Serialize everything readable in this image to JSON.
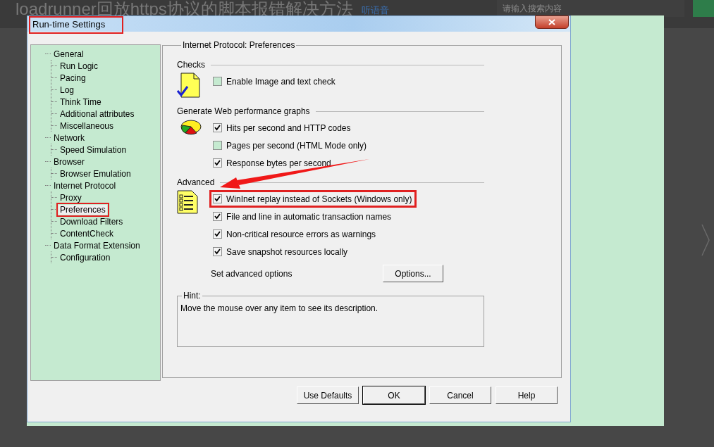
{
  "page": {
    "title": "loadrunner回放https协议的脚本报错解决方法",
    "listen_link": "听语音",
    "search": {
      "placeholder": "请输入搜索内容"
    }
  },
  "window": {
    "title": "Run-time Settings",
    "highlighted": true
  },
  "tree": [
    {
      "label": "General",
      "selected": false,
      "highlighted": false,
      "children": [
        {
          "label": "Run Logic",
          "selected": false,
          "highlighted": false
        },
        {
          "label": "Pacing",
          "selected": false,
          "highlighted": false
        },
        {
          "label": "Log",
          "selected": false,
          "highlighted": false
        },
        {
          "label": "Think Time",
          "selected": false,
          "highlighted": false
        },
        {
          "label": "Additional attributes",
          "selected": false,
          "highlighted": false
        },
        {
          "label": "Miscellaneous",
          "selected": false,
          "highlighted": false
        }
      ]
    },
    {
      "label": "Network",
      "selected": false,
      "highlighted": false,
      "children": [
        {
          "label": "Speed Simulation",
          "selected": false,
          "highlighted": false
        }
      ]
    },
    {
      "label": "Browser",
      "selected": false,
      "highlighted": false,
      "children": [
        {
          "label": "Browser Emulation",
          "selected": false,
          "highlighted": false
        }
      ]
    },
    {
      "label": "Internet Protocol",
      "selected": false,
      "highlighted": false,
      "children": [
        {
          "label": "Proxy",
          "selected": false,
          "highlighted": false
        },
        {
          "label": "Preferences",
          "selected": true,
          "highlighted": true
        },
        {
          "label": "Download Filters",
          "selected": false,
          "highlighted": false
        },
        {
          "label": "ContentCheck",
          "selected": false,
          "highlighted": false
        }
      ]
    },
    {
      "label": "Data Format Extension",
      "selected": false,
      "highlighted": false,
      "children": [
        {
          "label": "Configuration",
          "selected": false,
          "highlighted": false
        }
      ]
    }
  ],
  "panel": {
    "title": "Internet Protocol: Preferences",
    "sections": [
      {
        "title": "Checks",
        "kind": "document",
        "options": [
          {
            "label": "Enable Image and text check",
            "checked": false,
            "highlighted": false
          }
        ]
      },
      {
        "title": "Generate Web performance graphs",
        "kind": "pie",
        "options": [
          {
            "label": "Hits per second and HTTP codes",
            "checked": true,
            "highlighted": false
          },
          {
            "label": "Pages per second (HTML Mode only)",
            "checked": false,
            "highlighted": false
          },
          {
            "label": "Response bytes per second",
            "checked": true,
            "highlighted": false
          }
        ]
      },
      {
        "title": "Advanced",
        "kind": "list",
        "options": [
          {
            "label": "WinInet replay instead of Sockets (Windows only)",
            "checked": true,
            "highlighted": true
          },
          {
            "label": "File and line in automatic transaction names",
            "checked": true,
            "highlighted": false
          },
          {
            "label": "Non-critical resource errors as warnings",
            "checked": true,
            "highlighted": false
          },
          {
            "label": "Save snapshot resources locally",
            "checked": true,
            "highlighted": false
          }
        ]
      }
    ],
    "advanced_options": {
      "label": "Set advanced options",
      "button": "Options..."
    }
  },
  "hint": {
    "title": "Hint:",
    "text": "Move the mouse over any item to see its description."
  },
  "buttons": [
    {
      "label": "Use Defaults",
      "default": false
    },
    {
      "label": "OK",
      "default": true
    },
    {
      "label": "Cancel",
      "default": false
    },
    {
      "label": "Help",
      "default": false
    }
  ]
}
